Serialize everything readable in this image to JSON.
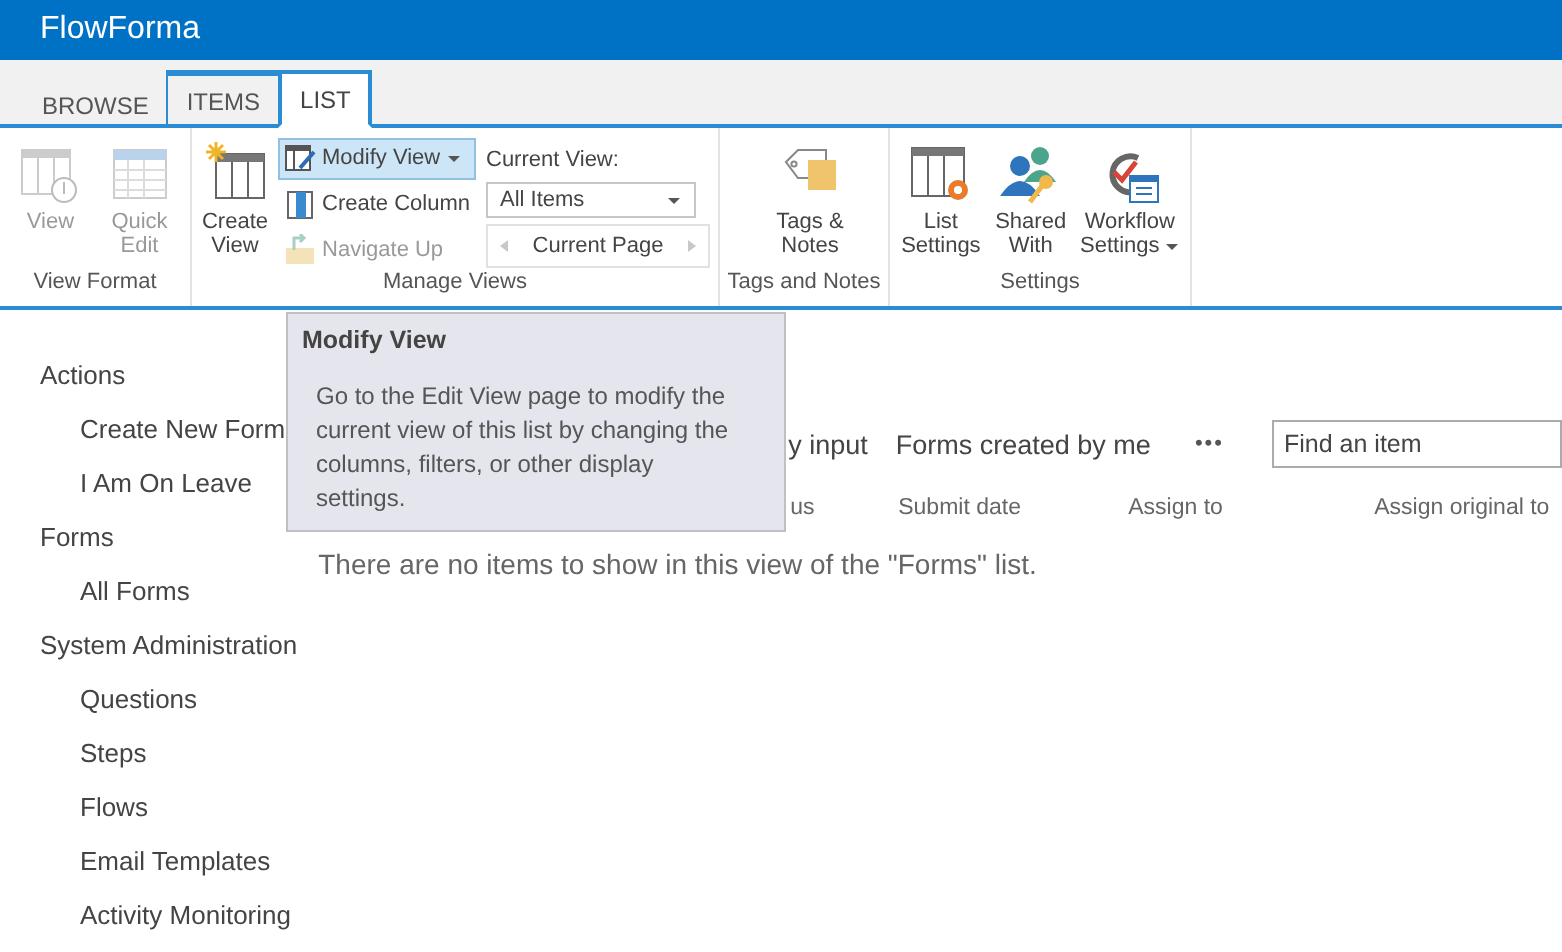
{
  "app": {
    "title": "FlowForma"
  },
  "tabs": [
    {
      "label": "BROWSE",
      "selected": false,
      "contextual": false
    },
    {
      "label": "ITEMS",
      "selected": false,
      "contextual": true
    },
    {
      "label": "LIST",
      "selected": true,
      "contextual": true
    }
  ],
  "ribbon": {
    "groups": [
      {
        "label": "View Format",
        "buttons": [
          {
            "label": "View",
            "disabled": true
          },
          {
            "label": "Quick Edit",
            "disabled": true
          }
        ]
      },
      {
        "label": "Manage Views",
        "buttons": [
          {
            "label": "Create View",
            "disabled": false
          }
        ],
        "small_buttons": [
          {
            "label": "Modify View",
            "disabled": false,
            "highlighted": true,
            "dropdown": true
          },
          {
            "label": "Create Column",
            "disabled": false,
            "highlighted": false,
            "dropdown": false
          },
          {
            "label": "Navigate Up",
            "disabled": true,
            "highlighted": false,
            "dropdown": false
          }
        ],
        "current_view": {
          "label": "Current View:",
          "value": "All Items",
          "pager": "Current Page"
        }
      },
      {
        "label": "Tags and Notes",
        "buttons": [
          {
            "label": "Tags & Notes",
            "disabled": false
          }
        ]
      },
      {
        "label": "Settings",
        "buttons": [
          {
            "label": "List Settings",
            "disabled": false,
            "dropdown": false
          },
          {
            "label": "Shared With",
            "disabled": false,
            "dropdown": false
          },
          {
            "label": "Workflow Settings",
            "disabled": false,
            "dropdown": true
          }
        ]
      }
    ]
  },
  "tooltip": {
    "title": "Modify View",
    "text": "Go to the Edit View page to modify the current view of this list by changing the columns, filters, or other display settings."
  },
  "sidebar": {
    "items": [
      {
        "label": "Actions",
        "children": [
          {
            "label": "Create New Form"
          },
          {
            "label": "I Am On Leave"
          }
        ]
      },
      {
        "label": "Forms",
        "children": [
          {
            "label": "All Forms"
          }
        ]
      },
      {
        "label": "System Administration",
        "children": [
          {
            "label": "Questions"
          },
          {
            "label": "Steps"
          },
          {
            "label": "Flows"
          },
          {
            "label": "Email Templates"
          },
          {
            "label": "Activity Monitoring"
          }
        ]
      }
    ]
  },
  "views": {
    "links": [
      "y input",
      "Forms created by me"
    ],
    "more": "•••",
    "search": {
      "placeholder": "Find an item"
    }
  },
  "table": {
    "columns": [
      "us",
      "Submit date",
      "Assign to",
      "Assign original to"
    ],
    "empty_message": "There are no items to show in this view of the \"Forms\" list."
  }
}
